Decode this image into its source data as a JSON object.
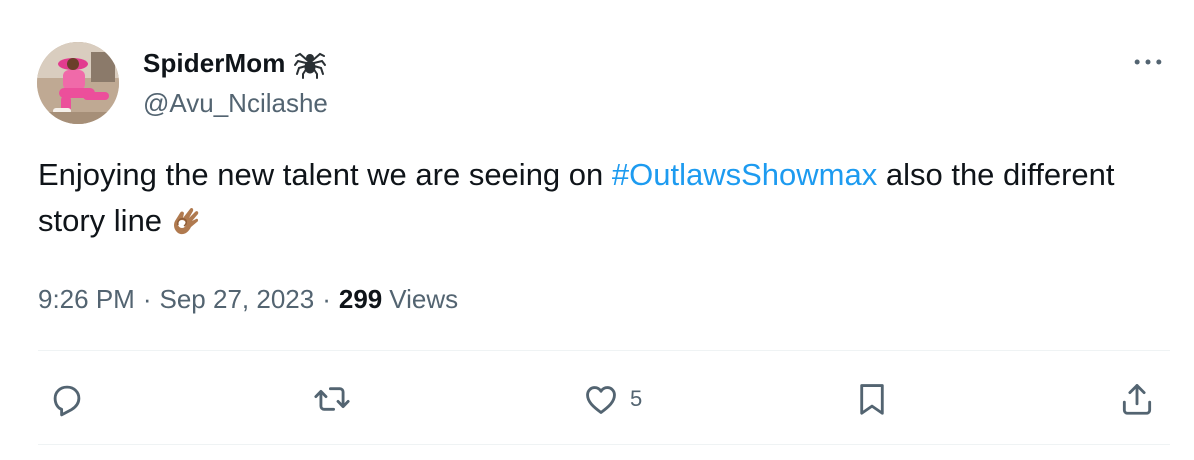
{
  "user": {
    "display_name": "SpiderMom",
    "name_emoji": "spider-emoji",
    "handle": "@Avu_Ncilashe"
  },
  "tweet": {
    "text_before": "Enjoying the new talent we are seeing on ",
    "hashtag": "#OutlawsShowmax",
    "text_after": " also the different story line",
    "trailing_emoji": "ok-hand-emoji-medium-skin-tone"
  },
  "meta": {
    "time": "9:26 PM",
    "separator": "·",
    "date": "Sep 27, 2023",
    "views_count": "299",
    "views_label": "Views"
  },
  "actions": {
    "reply_icon": "reply-icon",
    "retweet_icon": "retweet-icon",
    "like_icon": "heart-icon",
    "like_count": "5",
    "bookmark_icon": "bookmark-icon",
    "share_icon": "share-icon"
  },
  "colors": {
    "accent": "#1d9bf0",
    "text_primary": "#0f1419",
    "text_secondary": "#536471",
    "divider": "#eff3f4"
  }
}
